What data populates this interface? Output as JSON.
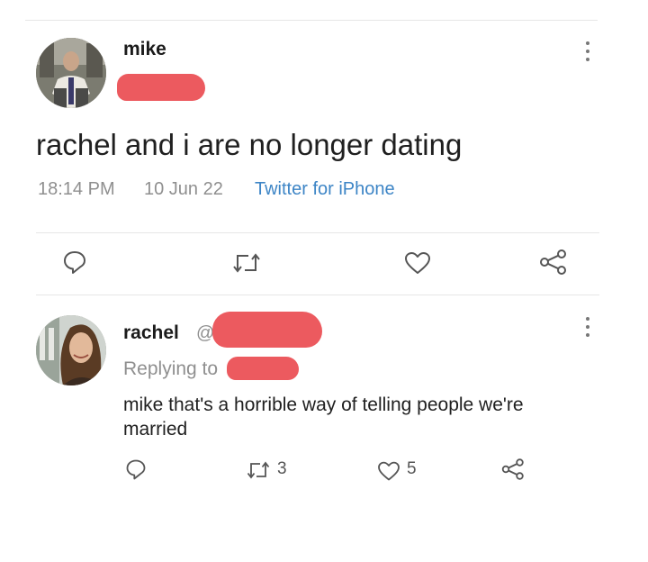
{
  "main_tweet": {
    "author_name": "mike",
    "text": "rachel and i are no longer dating",
    "time": "18:14 PM",
    "date": "10 Jun 22",
    "source": "Twitter for iPhone",
    "icons": [
      "reply-icon",
      "retweet-icon",
      "like-icon",
      "share-icon",
      "more-icon"
    ]
  },
  "reply_tweet": {
    "author_name": "rachel",
    "handle_prefix": "@",
    "replying_to": "Replying to",
    "text_line1": "mike that's a horrible way of telling people we're",
    "text_line2": "married",
    "retweet_count": "3",
    "like_count": "5",
    "icons": [
      "reply-icon",
      "retweet-icon",
      "like-icon",
      "share-icon",
      "more-icon"
    ]
  },
  "colors": {
    "redaction": "#ec5a5f",
    "link_blue": "#3d85c6",
    "muted_text": "#8f8f8f",
    "divider": "#e6e6e6"
  }
}
